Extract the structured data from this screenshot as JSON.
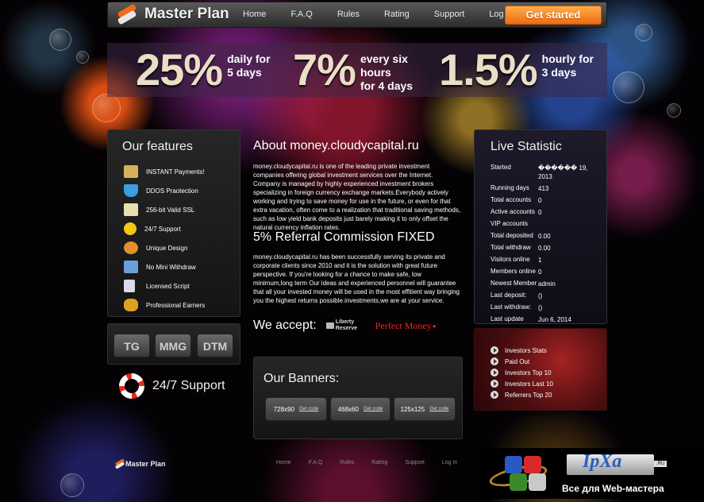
{
  "header": {
    "brand": "Master Plan",
    "nav": [
      "Home",
      "F.A.Q",
      "Rules",
      "Rating",
      "Support",
      "Log In"
    ],
    "cta": "Get started"
  },
  "rates": [
    {
      "value": "25%",
      "desc_lines": [
        "daily for",
        "5 days"
      ]
    },
    {
      "value": "7%",
      "desc_lines": [
        "every six",
        "hours",
        "for 4 days"
      ]
    },
    {
      "value": "1.5%",
      "desc_lines": [
        "hourly for",
        "3 days"
      ]
    }
  ],
  "features": {
    "title": "Our features",
    "items": [
      {
        "label": "INSTANT Payments!",
        "icon": "payments-icon",
        "color": "#d4b25a"
      },
      {
        "label": "DDOS Praotection",
        "icon": "shield-icon",
        "color": "#3a9ee0"
      },
      {
        "label": "256-bit Valid SSL",
        "icon": "certificate-icon",
        "color": "#e8e0b0"
      },
      {
        "label": "24/7 Support",
        "icon": "smiley-icon",
        "color": "#f5c518"
      },
      {
        "label": "Unique Design",
        "icon": "palette-icon",
        "color": "#e0902a"
      },
      {
        "label": "No Mini Withdraw",
        "icon": "monitor-icon",
        "color": "#6aa0d8"
      },
      {
        "label": "Licensed Script",
        "icon": "document-icon",
        "color": "#d9d9e8"
      },
      {
        "label": "Professional Earners",
        "icon": "coins-icon",
        "color": "#e0a020"
      }
    ]
  },
  "badges": [
    "TG",
    "MMG",
    "DTM"
  ],
  "support": {
    "label": "24/7 Support"
  },
  "about": {
    "title": "About money.cloudycapital.ru",
    "text": "money.cloudycapital.ru is one of the leading private investment companies offering global investment services over the Internet. Company is managed by highly experienced investment brokers specializing in foreign currency exchange markets.Everybody actively working and trying to save money for use in the future, or even for that extra vacation, often come to a realization that traditional saving methods, such as low yield bank deposits just barely making it to only offset the natural currency inflation rates."
  },
  "referral": {
    "title": "5% Referral Commission FIXED",
    "text": "money.cloudycapital.ru has been successfully serving its private and corporate clients since 2010 and it is the solution with great future perspective. If you're looking for a chance to make safe, low minimum,long term Our ideas and experienced personnel will guarantee that all your invested money will be used in the most effitient way bringing you the highest returns possible.investments,we are at your service."
  },
  "accept": {
    "label": "We accept:",
    "liberty_line1": "Liberty",
    "liberty_line2": "Reserve",
    "perfect_money": "Perfect Money"
  },
  "banners": {
    "title": "Our Banners:",
    "items": [
      {
        "size": "728x90",
        "link": "Get code"
      },
      {
        "size": "468x60",
        "link": "Get code"
      },
      {
        "size": "125x125",
        "link": "Get code"
      }
    ]
  },
  "stats": {
    "title": "Live Statistic",
    "rows": [
      {
        "k": "Started",
        "v": "������ 19, 2013"
      },
      {
        "k": "Running days",
        "v": "413"
      },
      {
        "k": "Total accounts",
        "v": "0"
      },
      {
        "k": "Active accounts",
        "v": "0"
      },
      {
        "k": "VIP accounts",
        "v": ""
      },
      {
        "k": "Total deposited",
        "v": "0.00"
      },
      {
        "k": "Total withdraw",
        "v": "0.00"
      },
      {
        "k": "Visitors online",
        "v": "1"
      },
      {
        "k": "Members online",
        "v": "0"
      },
      {
        "k": "Newest Member",
        "v": "admin"
      },
      {
        "k": "Last deposit:",
        "v": "()"
      },
      {
        "k": "Last withdraw:",
        "v": "()"
      },
      {
        "k": "Last update",
        "v": "Jun 6, 2014"
      }
    ]
  },
  "links": [
    "Investors Stats",
    "Paid Out",
    "Investors Top 10",
    "Investors Last 10",
    "Referrers Top 20"
  ],
  "footer": {
    "brand": "Master Plan",
    "nav": [
      "Home",
      "F.A.Q",
      "Rules",
      "Rating",
      "Support",
      "Log In"
    ]
  },
  "watermark": {
    "name": "IpXa",
    "ru": ".RU",
    "tagline": "Все для Web-мастера"
  },
  "colors": {
    "accent": "#f06a10",
    "referral_red": "#e8261b"
  }
}
